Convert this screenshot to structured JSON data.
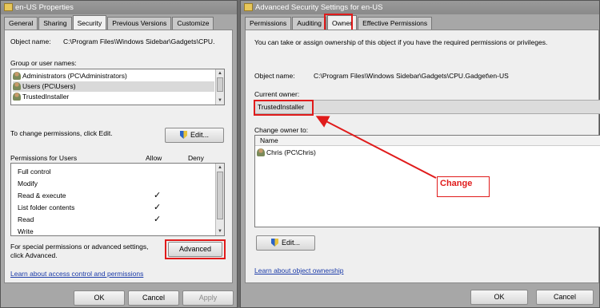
{
  "left": {
    "title": "en-US Properties",
    "tabs": [
      "General",
      "Sharing",
      "Security",
      "Previous Versions",
      "Customize"
    ],
    "object_name_label": "Object name:",
    "object_name_value": "C:\\Program Files\\Windows Sidebar\\Gadgets\\CPU.",
    "group_label": "Group or user names:",
    "users": [
      {
        "name": "Administrators (PC\\Administrators)"
      },
      {
        "name": "Users (PC\\Users)"
      },
      {
        "name": "TrustedInstaller"
      }
    ],
    "change_perm_text": "To change permissions, click Edit.",
    "edit_label": "Edit...",
    "perm_header": "Permissions for Users",
    "allow_label": "Allow",
    "deny_label": "Deny",
    "permissions": [
      {
        "name": "Full control",
        "allow": false
      },
      {
        "name": "Modify",
        "allow": false
      },
      {
        "name": "Read & execute",
        "allow": true
      },
      {
        "name": "List folder contents",
        "allow": true
      },
      {
        "name": "Read",
        "allow": true
      },
      {
        "name": "Write",
        "allow": false
      }
    ],
    "special_text_1": "For special permissions or advanced settings,",
    "special_text_2": "click Advanced.",
    "advanced_label": "Advanced",
    "learn_link": "Learn about access control and permissions",
    "ok": "OK",
    "cancel": "Cancel",
    "apply": "Apply"
  },
  "right": {
    "title": "Advanced Security Settings for en-US",
    "tabs": [
      "Permissions",
      "Auditing",
      "Owner",
      "Effective Permissions"
    ],
    "info": "You can take or assign ownership of this object if you have the required permissions or privileges.",
    "object_name_label": "Object name:",
    "object_name_value": "C:\\Program Files\\Windows Sidebar\\Gadgets\\CPU.Gadget\\en-US",
    "current_owner_label": "Current owner:",
    "current_owner_value": "TrustedInstaller",
    "change_owner_label": "Change owner to:",
    "name_header": "Name",
    "owners": [
      {
        "name": "Chris (PC\\Chris)"
      }
    ],
    "edit_label": "Edit...",
    "learn_link": "Learn about object ownership",
    "ok": "OK",
    "cancel": "Cancel"
  },
  "annotation": {
    "change_label": "Change",
    "color": "#e01b1b"
  }
}
